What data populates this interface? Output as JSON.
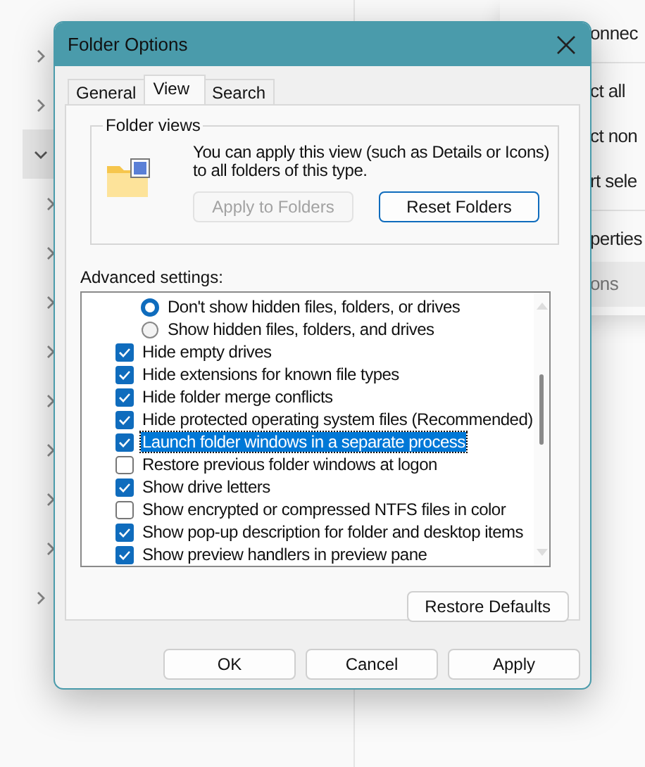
{
  "background_menu": {
    "items": [
      {
        "label": "onnec",
        "divider_after": true,
        "selected": false
      },
      {
        "label": "ct all",
        "divider_after": false,
        "selected": false
      },
      {
        "label": "ct non",
        "divider_after": false,
        "selected": false
      },
      {
        "label": "rt sele",
        "divider_after": true,
        "selected": false
      },
      {
        "label": "perties",
        "divider_after": false,
        "selected": false
      },
      {
        "label": "ons",
        "divider_after": false,
        "selected": true
      }
    ]
  },
  "navigation_pane": {
    "items": [
      {
        "expanded": false,
        "nested": false
      },
      {
        "expanded": false,
        "nested": false
      },
      {
        "expanded": true,
        "nested": false
      },
      {
        "expanded": false,
        "nested": true
      },
      {
        "expanded": false,
        "nested": true
      },
      {
        "expanded": false,
        "nested": true
      },
      {
        "expanded": false,
        "nested": true
      },
      {
        "expanded": false,
        "nested": true
      },
      {
        "expanded": false,
        "nested": true
      },
      {
        "expanded": false,
        "nested": true
      },
      {
        "expanded": false,
        "nested": true
      },
      {
        "expanded": false,
        "nested": false
      }
    ]
  },
  "window": {
    "title": "Folder Options"
  },
  "tabs": [
    {
      "label": "General",
      "selected": false
    },
    {
      "label": "View",
      "selected": true
    },
    {
      "label": "Search",
      "selected": false
    }
  ],
  "folder_views": {
    "title": "Folder views",
    "description": "You can apply this view (such as Details or Icons) to all folders of this type.",
    "buttons": [
      {
        "label": "Apply to Folders",
        "disabled": true,
        "default": false
      },
      {
        "label": "Reset Folders",
        "disabled": false,
        "default": true
      }
    ]
  },
  "advanced_settings": {
    "label": "Advanced settings:",
    "items": [
      {
        "kind": "radio",
        "label": "Don't show hidden files, folders, or drives",
        "selected": true,
        "focused": false
      },
      {
        "kind": "radio",
        "label": "Show hidden files, folders, and drives",
        "selected": false,
        "focused": false
      },
      {
        "kind": "checkbox",
        "label": "Hide empty drives",
        "checked": true,
        "focused": false
      },
      {
        "kind": "checkbox",
        "label": "Hide extensions for known file types",
        "checked": true,
        "focused": false
      },
      {
        "kind": "checkbox",
        "label": "Hide folder merge conflicts",
        "checked": true,
        "focused": false
      },
      {
        "kind": "checkbox",
        "label": "Hide protected operating system files (Recommended)",
        "checked": true,
        "focused": false
      },
      {
        "kind": "checkbox",
        "label": "Launch folder windows in a separate process",
        "checked": true,
        "focused": true
      },
      {
        "kind": "checkbox",
        "label": "Restore previous folder windows at logon",
        "checked": false,
        "focused": false
      },
      {
        "kind": "checkbox",
        "label": "Show drive letters",
        "checked": true,
        "focused": false
      },
      {
        "kind": "checkbox",
        "label": "Show encrypted or compressed NTFS files in color",
        "checked": false,
        "focused": false
      },
      {
        "kind": "checkbox",
        "label": "Show pop-up description for folder and desktop items",
        "checked": true,
        "focused": false
      },
      {
        "kind": "checkbox",
        "label": "Show preview handlers in preview pane",
        "checked": true,
        "focused": false
      }
    ],
    "restore_button": "Restore Defaults"
  },
  "buttons": [
    "OK",
    "Cancel",
    "Apply"
  ]
}
